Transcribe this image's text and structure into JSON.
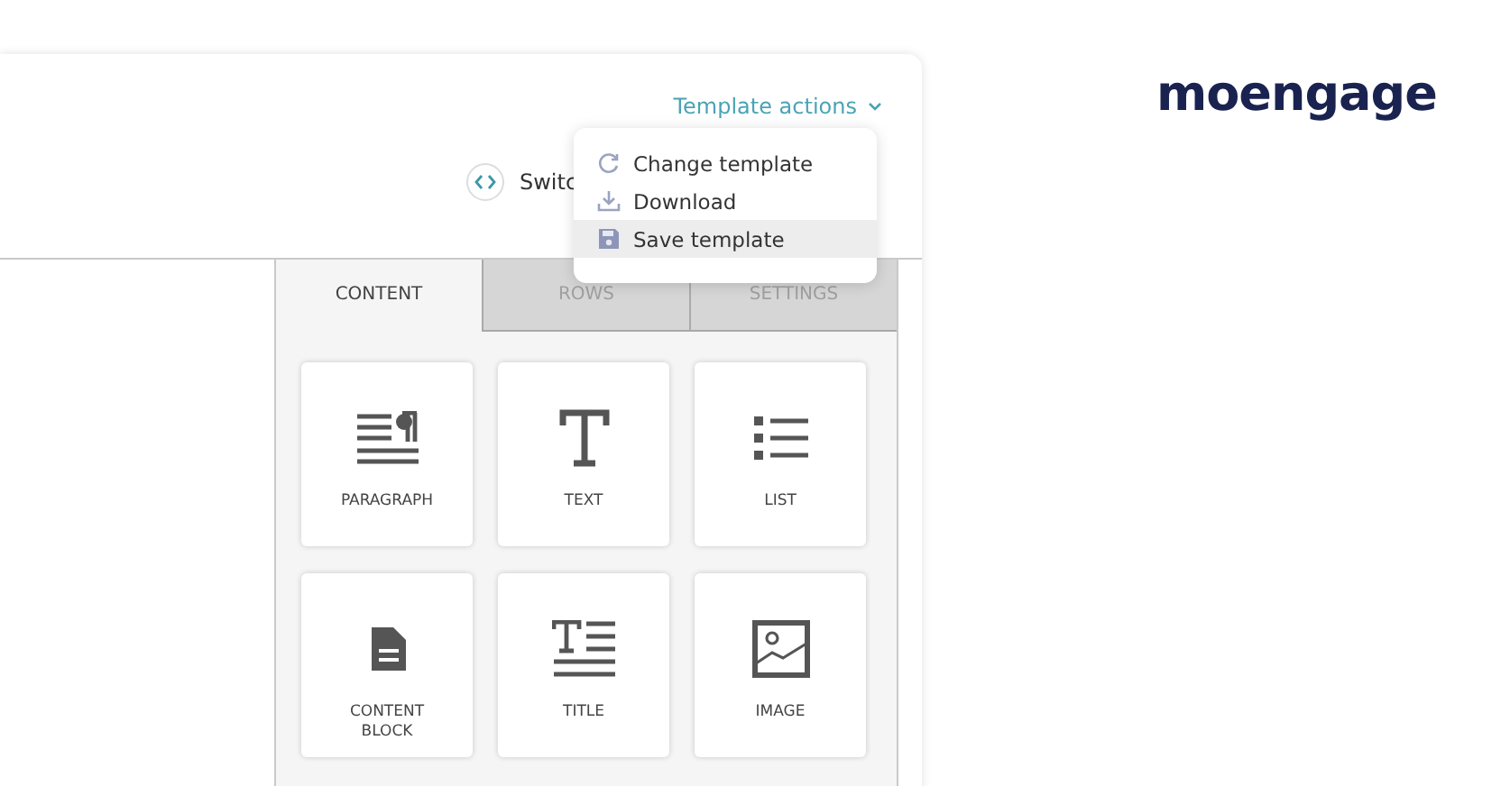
{
  "header": {
    "template_actions": "Template actions",
    "switch_button": "Switc"
  },
  "template_menu": [
    {
      "label": "Change template",
      "kind": "refresh",
      "selected": false
    },
    {
      "label": "Download",
      "kind": "download",
      "selected": false
    },
    {
      "label": "Save template",
      "kind": "save",
      "selected": true
    }
  ],
  "tabs": [
    {
      "label": "CONTENT",
      "selected": true
    },
    {
      "label": "ROWS",
      "selected": false
    },
    {
      "label": "SETTINGS",
      "selected": false
    }
  ],
  "blocks": [
    {
      "label": "PARAGRAPH",
      "kind": "paragraph"
    },
    {
      "label": "TEXT",
      "kind": "text"
    },
    {
      "label": "LIST",
      "kind": "list"
    },
    {
      "label": "CONTENT BLOCK",
      "kind": "content-block"
    },
    {
      "label": "TITLE",
      "kind": "title"
    },
    {
      "label": "IMAGE",
      "kind": "image"
    }
  ],
  "logo": "moengage"
}
